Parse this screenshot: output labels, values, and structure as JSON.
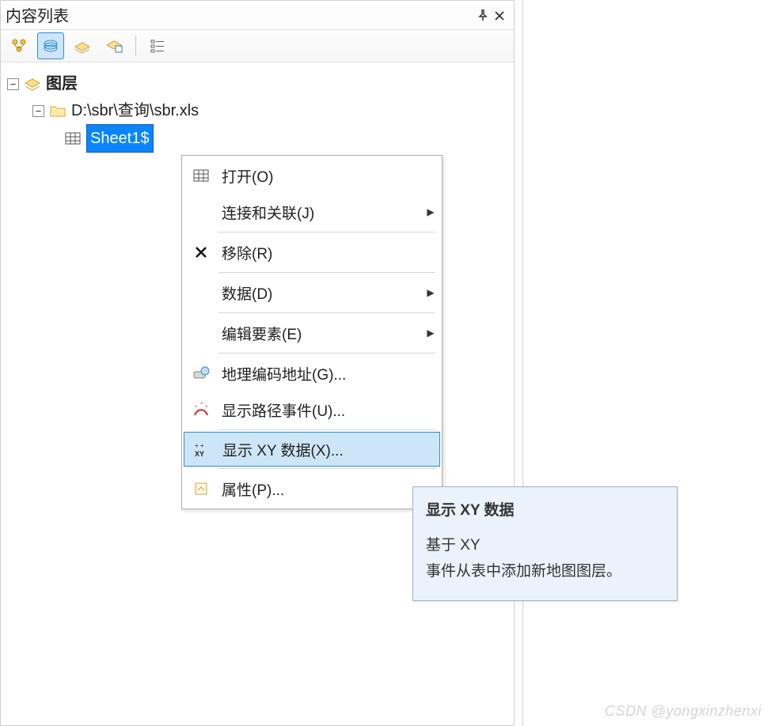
{
  "panel": {
    "title": "内容列表",
    "pin_glyph": "☒",
    "close_glyph": "✕"
  },
  "toolbar": {
    "items": [
      {
        "name": "list-by-source-icon"
      },
      {
        "name": "list-by-drawing-icon",
        "selected": true
      },
      {
        "name": "list-by-kind-icon"
      },
      {
        "name": "list-by-selection-icon"
      },
      {
        "name": "options-icon"
      }
    ]
  },
  "tree": {
    "root": {
      "label": "图层",
      "icon": "layers-icon"
    },
    "folder": {
      "label": "D:\\sbr\\查询\\sbr.xls",
      "icon": "folder-icon"
    },
    "sheet": {
      "label": "Sheet1$",
      "icon": "table-icon",
      "selected": true
    }
  },
  "menu": {
    "items": [
      {
        "icon": "table-icon",
        "label": "打开(O)",
        "arrow": false
      },
      {
        "icon": "",
        "label": "连接和关联(J)",
        "arrow": true
      },
      {
        "sep": true
      },
      {
        "icon": "remove-icon",
        "label": "移除(R)",
        "arrow": false
      },
      {
        "sep": true
      },
      {
        "icon": "",
        "label": "数据(D)",
        "arrow": true
      },
      {
        "sep": true
      },
      {
        "icon": "",
        "label": "编辑要素(E)",
        "arrow": true
      },
      {
        "sep": true
      },
      {
        "icon": "geocode-icon",
        "label": "地理编码地址(G)...",
        "arrow": false
      },
      {
        "icon": "route-icon",
        "label": "显示路径事件(U)...",
        "arrow": false
      },
      {
        "sep": true
      },
      {
        "icon": "xy-icon",
        "label": "显示 XY 数据(X)...",
        "arrow": false,
        "highlight": true
      },
      {
        "sep": true
      },
      {
        "icon": "props-icon",
        "label": "属性(P)...",
        "arrow": false
      }
    ],
    "arrow_glyph": "▶"
  },
  "tooltip": {
    "title": "显示 XY 数据",
    "line1": "基于 XY",
    "line2": "事件从表中添加新地图图层。"
  },
  "watermark": "CSDN @yongxinzhenxi"
}
